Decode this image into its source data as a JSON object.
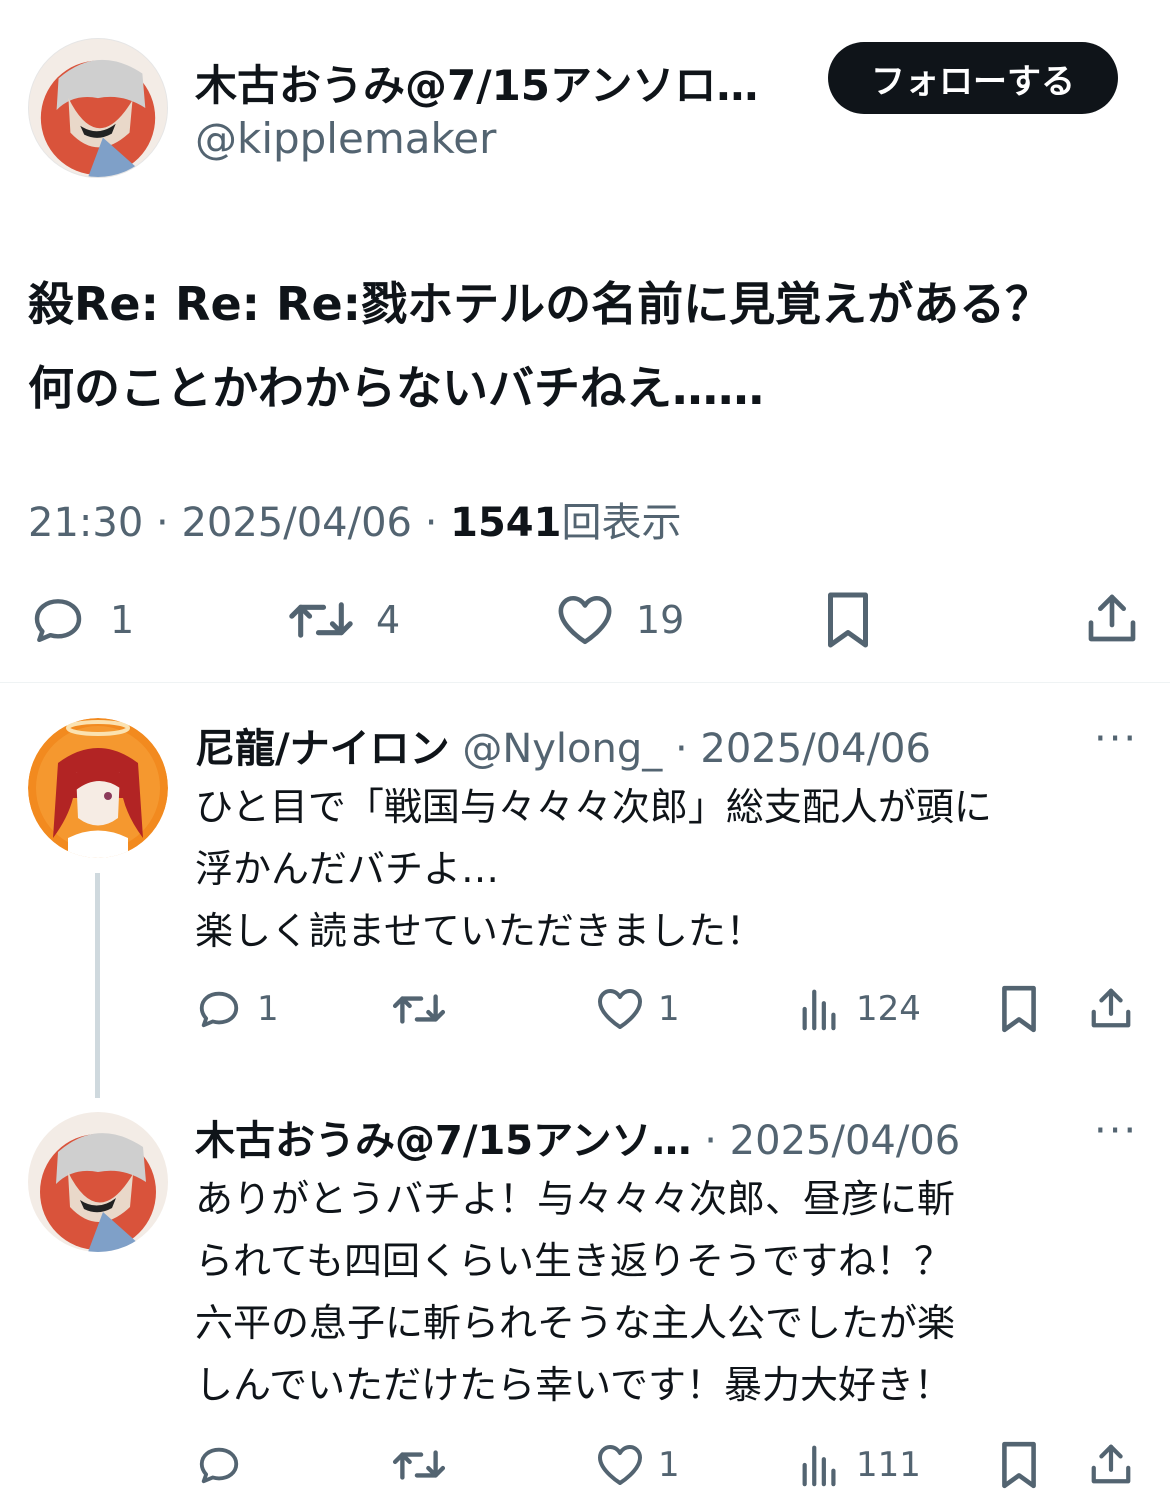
{
  "main_tweet": {
    "display_name": "木古おうみ@7/15アンソロ…",
    "handle": "@kipplemaker",
    "follow_label": "フォローする",
    "text_line1": "殺Re: Re: Re:戮ホテルの名前に見覚えがある？",
    "text_line2": "何のことかわからないバチねえ……",
    "time": "21:30",
    "sep": "·",
    "date": "2025/04/06",
    "views_count": "1541",
    "views_label": "回表示",
    "stats": {
      "replies": "1",
      "retweets": "4",
      "likes": "19"
    }
  },
  "replies": [
    {
      "display_name": "尼龍/ナイロン",
      "handle": "@Nylong_",
      "sep": "·",
      "date": "2025/04/06",
      "more": "···",
      "line1": "ひと目で「戦国与々々々次郎」総支配人が頭に",
      "line2": "浮かんだバチよ…",
      "line3": "楽しく読ませていただきました！",
      "stats": {
        "replies": "1",
        "retweets": "",
        "likes": "1",
        "views": "124"
      }
    },
    {
      "display_name": "木古おうみ@7/15アンソ…",
      "sep": "·",
      "date": "2025/04/06",
      "more": "···",
      "line1": "ありがとうバチよ！与々々々次郎、昼彦に斬",
      "line2": "られても四回くらい生き返りそうですね！？",
      "line3": "六平の息子に斬られそうな主人公でしたが楽",
      "line4": "しんでいただけたら幸いです！暴力大好き！",
      "stats": {
        "replies": "",
        "retweets": "",
        "likes": "1",
        "views": "111"
      }
    }
  ],
  "colors": {
    "text": "#0f1419",
    "secondary": "#536471",
    "button_bg": "#0f1419",
    "divider": "#eff3f4"
  }
}
